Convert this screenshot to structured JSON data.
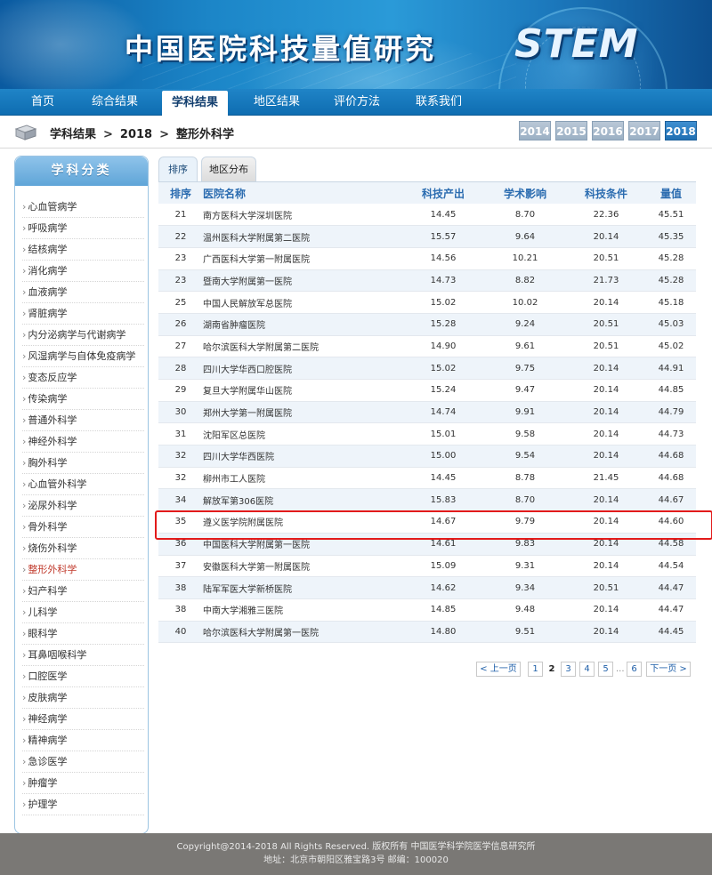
{
  "header": {
    "site_title": "中国医院科技量值研究",
    "logo_text": "STEM"
  },
  "nav": {
    "items": [
      {
        "label": "首页",
        "active": false
      },
      {
        "label": "综合结果",
        "active": false
      },
      {
        "label": "学科结果",
        "active": true
      },
      {
        "label": "地区结果",
        "active": false
      },
      {
        "label": "评价方法",
        "active": false
      },
      {
        "label": "联系我们",
        "active": false
      }
    ]
  },
  "breadcrumb": {
    "section": "学科结果",
    "year": "2018",
    "subject": "整形外科学",
    "separator": ">"
  },
  "years": [
    {
      "label": "2014",
      "active": false
    },
    {
      "label": "2015",
      "active": false
    },
    {
      "label": "2016",
      "active": false
    },
    {
      "label": "2017",
      "active": false
    },
    {
      "label": "2018",
      "active": true
    }
  ],
  "sidebar": {
    "title": "学科分类",
    "bullet": "›",
    "items": [
      "心血管病学",
      "呼吸病学",
      "结核病学",
      "消化病学",
      "血液病学",
      "肾脏病学",
      "内分泌病学与代谢病学",
      "风湿病学与自体免疫病学",
      "变态反应学",
      "传染病学",
      "普通外科学",
      "神经外科学",
      "胸外科学",
      "心血管外科学",
      "泌尿外科学",
      "骨外科学",
      "烧伤外科学",
      "整形外科学",
      "妇产科学",
      "儿科学",
      "眼科学",
      "耳鼻咽喉科学",
      "口腔医学",
      "皮肤病学",
      "神经病学",
      "精神病学",
      "急诊医学",
      "肿瘤学",
      "护理学"
    ],
    "active_item": "整形外科学"
  },
  "tabs": {
    "rank": "排序",
    "region": "地区分布"
  },
  "table": {
    "headers": [
      "排序",
      "医院名称",
      "科技产出",
      "学术影响",
      "科技条件",
      "量值"
    ],
    "rows": [
      [
        "21",
        "南方医科大学深圳医院",
        "14.45",
        "8.70",
        "22.36",
        "45.51"
      ],
      [
        "22",
        "温州医科大学附属第二医院",
        "15.57",
        "9.64",
        "20.14",
        "45.35"
      ],
      [
        "23",
        "广西医科大学第一附属医院",
        "14.56",
        "10.21",
        "20.51",
        "45.28"
      ],
      [
        "23",
        "暨南大学附属第一医院",
        "14.73",
        "8.82",
        "21.73",
        "45.28"
      ],
      [
        "25",
        "中国人民解放军总医院",
        "15.02",
        "10.02",
        "20.14",
        "45.18"
      ],
      [
        "26",
        "湖南省肿瘤医院",
        "15.28",
        "9.24",
        "20.51",
        "45.03"
      ],
      [
        "27",
        "哈尔滨医科大学附属第二医院",
        "14.90",
        "9.61",
        "20.51",
        "45.02"
      ],
      [
        "28",
        "四川大学华西口腔医院",
        "15.02",
        "9.75",
        "20.14",
        "44.91"
      ],
      [
        "29",
        "复旦大学附属华山医院",
        "15.24",
        "9.47",
        "20.14",
        "44.85"
      ],
      [
        "30",
        "郑州大学第一附属医院",
        "14.74",
        "9.91",
        "20.14",
        "44.79"
      ],
      [
        "31",
        "沈阳军区总医院",
        "15.01",
        "9.58",
        "20.14",
        "44.73"
      ],
      [
        "32",
        "四川大学华西医院",
        "15.00",
        "9.54",
        "20.14",
        "44.68"
      ],
      [
        "32",
        "柳州市工人医院",
        "14.45",
        "8.78",
        "21.45",
        "44.68"
      ],
      [
        "34",
        "解放军第306医院",
        "15.83",
        "8.70",
        "20.14",
        "44.67"
      ],
      [
        "35",
        "遵义医学院附属医院",
        "14.67",
        "9.79",
        "20.14",
        "44.60"
      ],
      [
        "36",
        "中国医科大学附属第一医院",
        "14.61",
        "9.83",
        "20.14",
        "44.58"
      ],
      [
        "37",
        "安徽医科大学第一附属医院",
        "15.09",
        "9.31",
        "20.14",
        "44.54"
      ],
      [
        "38",
        "陆军军医大学新桥医院",
        "14.62",
        "9.34",
        "20.51",
        "44.47"
      ],
      [
        "38",
        "中南大学湘雅三医院",
        "14.85",
        "9.48",
        "20.14",
        "44.47"
      ],
      [
        "40",
        "哈尔滨医科大学附属第一医院",
        "14.80",
        "9.51",
        "20.14",
        "44.45"
      ]
    ],
    "highlighted_row_rank": "35",
    "highlight_color": "#e21b1b"
  },
  "pagination": {
    "prev": "< 上一页",
    "pages": [
      "1",
      "2",
      "3",
      "4",
      "5",
      "6"
    ],
    "current": "2",
    "ellipsis": "...",
    "next": "下一页 >"
  },
  "footer": {
    "line1": "Copyright@2014-2018 All Rights Reserved. 版权所有 中国医学科学院医学信息研究所",
    "line2": "地址：北京市朝阳区雅宝路3号 邮编：100020"
  },
  "colors": {
    "nav_bg": "#1378bf",
    "accent": "#2b6cb0",
    "active_sidebar": "#c0392b",
    "footer_bg": "#7a7875"
  }
}
